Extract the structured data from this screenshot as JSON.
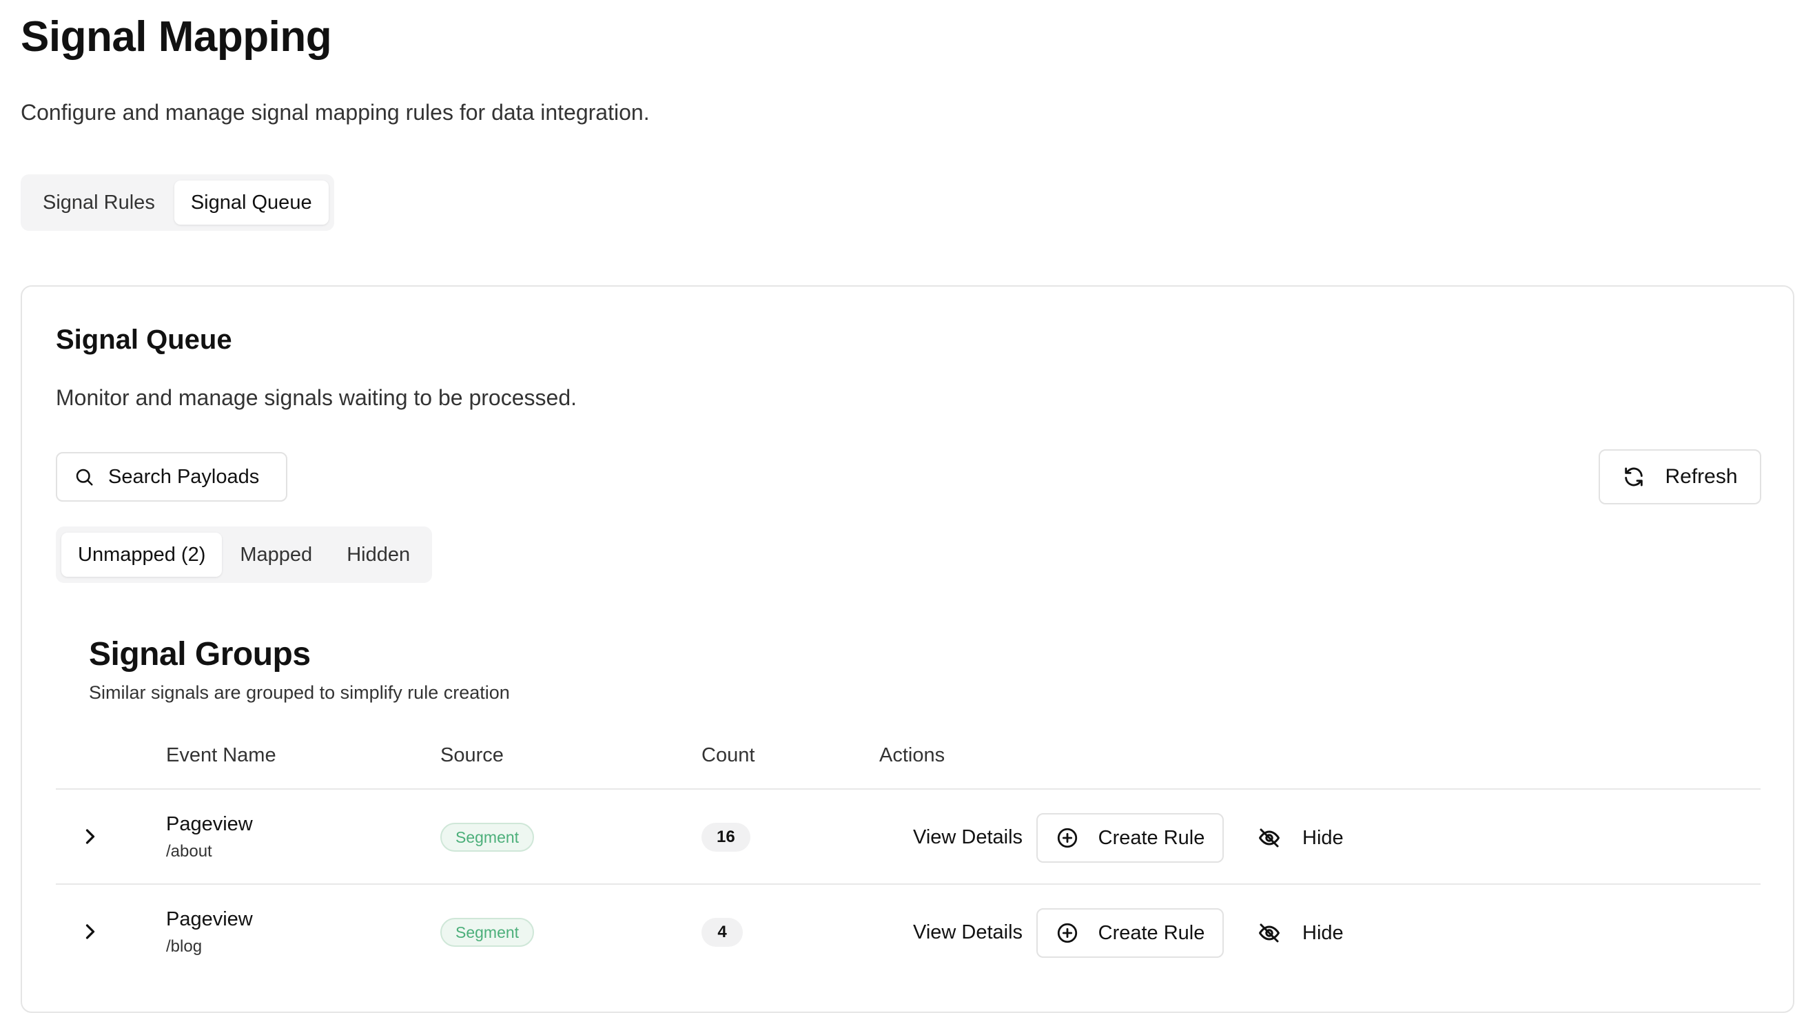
{
  "page": {
    "title": "Signal Mapping",
    "subtitle": "Configure and manage signal mapping rules for data integration."
  },
  "main_tabs": [
    {
      "label": "Signal Rules",
      "active": false
    },
    {
      "label": "Signal Queue",
      "active": true
    }
  ],
  "queue": {
    "title": "Signal Queue",
    "description": "Monitor and manage signals waiting to be processed.",
    "search_placeholder": "Search Payloads",
    "refresh_label": "Refresh",
    "sub_tabs": [
      {
        "label": "Unmapped (2)",
        "active": true
      },
      {
        "label": "Mapped",
        "active": false
      },
      {
        "label": "Hidden",
        "active": false
      }
    ]
  },
  "groups": {
    "title": "Signal Groups",
    "description": "Similar signals are grouped to simplify rule creation",
    "columns": [
      "Event Name",
      "Source",
      "Count",
      "Actions"
    ],
    "rows": [
      {
        "event": "Pageview",
        "path": "/about",
        "source": "Segment",
        "count": "16",
        "view_label": "View Details",
        "create_label": "Create Rule",
        "hide_label": "Hide"
      },
      {
        "event": "Pageview",
        "path": "/blog",
        "source": "Segment",
        "count": "4",
        "view_label": "View Details",
        "create_label": "Create Rule",
        "hide_label": "Hide"
      }
    ]
  },
  "colors": {
    "source_badge_text": "#4caf7a",
    "source_badge_bg": "#eef7f1",
    "tab_track": "#f4f4f5",
    "border": "#e2e2e2"
  },
  "icons": {
    "search": "search-icon",
    "refresh": "refresh-icon",
    "expand": "chevron-right-icon",
    "create": "plus-circle-icon",
    "hide": "eye-off-icon"
  }
}
